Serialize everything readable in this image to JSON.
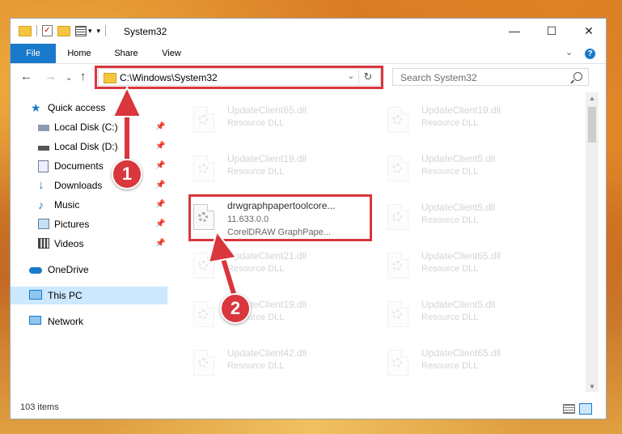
{
  "window": {
    "title": "System32",
    "tabs": [
      "File",
      "Home",
      "Share",
      "View"
    ],
    "help": "?"
  },
  "address": {
    "path": "C:\\Windows\\System32",
    "search_placeholder": "Search System32"
  },
  "nav_pane": {
    "quick_access": "Quick access",
    "items": [
      {
        "label": "Local Disk (C:)",
        "icon": "drive-icon"
      },
      {
        "label": "Local Disk (D:)",
        "icon": "drive-icon"
      },
      {
        "label": "Documents",
        "icon": "documents-icon"
      },
      {
        "label": "Downloads",
        "icon": "downloads-icon"
      },
      {
        "label": "Music",
        "icon": "music-icon"
      },
      {
        "label": "Pictures",
        "icon": "pictures-icon"
      },
      {
        "label": "Videos",
        "icon": "videos-icon"
      }
    ],
    "onedrive": "OneDrive",
    "this_pc": "This PC",
    "network": "Network"
  },
  "files": [
    {
      "name": "UpdateClient65.dll",
      "sub": "Resource DLL",
      "faded": true
    },
    {
      "name": "UpdateClient19.dll",
      "sub": "Resource DLL",
      "faded": true
    },
    {
      "name": "UpdateClient19.dll",
      "sub": "Resource DLL",
      "faded": true
    },
    {
      "name": "UpdateClient5.dll",
      "sub": "Resource DLL",
      "faded": true
    },
    {
      "name": "drwgraphpapertoolcore...",
      "version": "11.633.0.0",
      "sub": "CorelDRAW GraphPape...",
      "faded": false
    },
    {
      "name": "UpdateClient5.dll",
      "sub": "Resource DLL",
      "faded": true
    },
    {
      "name": "UpdateClient21.dll",
      "sub": "Resource DLL",
      "faded": true
    },
    {
      "name": "UpdateClient65.dll",
      "sub": "Resource DLL",
      "faded": true
    },
    {
      "name": "UpdateClient19.dll",
      "sub": "Resource DLL",
      "faded": true
    },
    {
      "name": "UpdateClient5.dll",
      "sub": "Resource DLL",
      "faded": true
    },
    {
      "name": "UpdateClient42.dll",
      "sub": "Resource DLL",
      "faded": true
    },
    {
      "name": "UpdateClient65.dll",
      "sub": "Resource DLL",
      "faded": true
    }
  ],
  "status": {
    "items_count": "103 items"
  },
  "annotations": {
    "step1": "1",
    "step2": "2"
  },
  "colors": {
    "accent": "#1979ca",
    "highlight": "#d9363e",
    "selected": "#cce8ff"
  }
}
